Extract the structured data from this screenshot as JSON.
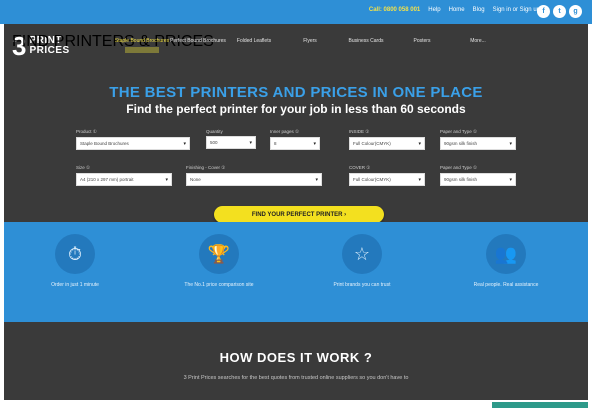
{
  "topbar": {
    "phone": "Call: 0800 058 001",
    "links": [
      "Help",
      "Home",
      "Blog",
      "Sign in or Sign up"
    ],
    "social": [
      {
        "icon": "facebook-icon",
        "glyph": "f"
      },
      {
        "icon": "twitter-icon",
        "glyph": "t"
      },
      {
        "icon": "google-plus-icon",
        "glyph": "g"
      }
    ]
  },
  "logo": {
    "mark": "3",
    "line1": "PRINT",
    "line2": "PRICES",
    "tagline": "FIND PRINTERS & PRICES"
  },
  "nav": [
    {
      "label": "Staple Bound Brochures",
      "active": true
    },
    {
      "label": "Perfect Bound Brochures",
      "active": false
    },
    {
      "label": "Folded Leaflets",
      "active": false
    },
    {
      "label": "Flyers",
      "active": false
    },
    {
      "label": "Business Cards",
      "active": false
    },
    {
      "label": "Posters",
      "active": false
    },
    {
      "label": "More...",
      "active": false
    }
  ],
  "hero": {
    "title": "THE BEST PRINTERS AND PRICES IN ONE PLACE",
    "subtitle": "Find the perfect printer for your job in less than 60 seconds"
  },
  "form": {
    "product": {
      "label": "Product ①",
      "value": "Staple Bound Brochures"
    },
    "quantity": {
      "label": "Quantity",
      "value": "500"
    },
    "pages": {
      "label": "Inner pages ①",
      "value": "8"
    },
    "inside_colour": {
      "label": "INSIDE ①",
      "value": "Full Colour(CMYK)"
    },
    "paper_inner": {
      "label": "Paper and Type ①",
      "value": "90gsm silk finish"
    },
    "size": {
      "label": "Size ①",
      "value": "A4 (210 x 297 mm) portrait"
    },
    "finishing": {
      "label": "Finishing - Cover ①",
      "value": "None"
    },
    "cover_colour": {
      "label": "COVER ①",
      "value": "Full Colour(CMYK)"
    },
    "paper_cover": {
      "label": "Paper and Type ①",
      "value": "90gsm silk finish"
    }
  },
  "cta": {
    "label": "FIND YOUR PERFECT PRINTER  ›"
  },
  "features": [
    {
      "icon": "stopwatch-icon",
      "glyph": "⏱",
      "label": "Order in just 1 minute"
    },
    {
      "icon": "trophy-icon",
      "glyph": "🏆",
      "label": "The No.1 price comparison site"
    },
    {
      "icon": "star-icon",
      "glyph": "☆",
      "label": "Print brands you can trust"
    },
    {
      "icon": "people-icon",
      "glyph": "👥",
      "label": "Real people. Real assistance"
    }
  ],
  "how": {
    "title": "HOW DOES IT WORK ?",
    "subtitle": "3 Print Prices searches for the best quotes from trusted online suppliers so you don't have to"
  },
  "colors": {
    "accent_blue": "#2e8fd6",
    "dark_bg": "#3a3a3a",
    "cta_yellow": "#f3e01f",
    "title_blue": "#3aa0e8"
  }
}
